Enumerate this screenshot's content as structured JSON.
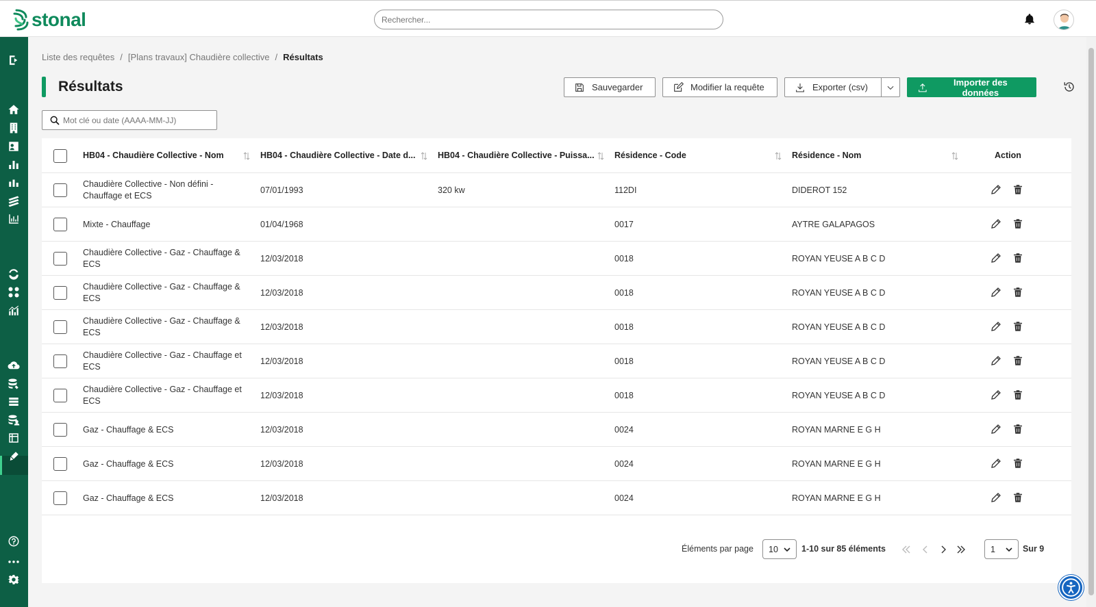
{
  "header": {
    "logo_text": "stonal",
    "search_placeholder": "Rechercher...",
    "icons": [
      "bell-icon",
      "user-avatar"
    ]
  },
  "sidebar": {
    "icons": [
      "collapse-icon",
      "home-icon",
      "building-icon",
      "contact-card-icon",
      "bar-chart-icon",
      "bar-chart-alt-icon",
      "layers-icon",
      "analytics-icon",
      "sync-icon",
      "apps-icon",
      "trend-chart-icon",
      "cloud-upload-icon",
      "database-edit-icon",
      "list-icon",
      "database-user-icon",
      "table-icon",
      "pen-icon",
      "help-icon",
      "more-icon",
      "settings-icon"
    ],
    "active": "database-user-icon"
  },
  "breadcrumb": {
    "items": [
      "Liste des requêtes",
      "[Plans travaux] Chaudière collective",
      "Résultats"
    ],
    "separator": "/"
  },
  "page": {
    "title": "Résultats"
  },
  "toolbar": {
    "save_label": "Sauvegarder",
    "edit_label": "Modifier la requête",
    "export_label": "Exporter (csv)",
    "import_label": "Importer des données"
  },
  "filter": {
    "placeholder": "Mot clé ou date (AAAA-MM-JJ)"
  },
  "table": {
    "columns": [
      "HB04 - Chaudière Collective - Nom",
      "HB04 - Chaudière Collective - Date d...",
      "HB04 - Chaudière Collective - Puissa...",
      "Résidence - Code",
      "Résidence - Nom",
      "Action"
    ],
    "rows": [
      {
        "nom": "Chaudière Collective - Non défini - Chauffage et ECS",
        "date": "07/01/1993",
        "puissance": "320 kw",
        "code": "112DI",
        "residence": "DIDEROT 152"
      },
      {
        "nom": "Mixte - Chauffage",
        "date": "01/04/1968",
        "puissance": "",
        "code": "0017",
        "residence": "AYTRE GALAPAGOS"
      },
      {
        "nom": "Chaudière Collective - Gaz - Chauffage & ECS",
        "date": "12/03/2018",
        "puissance": "",
        "code": "0018",
        "residence": "ROYAN YEUSE A B C D"
      },
      {
        "nom": "Chaudière Collective - Gaz - Chauffage & ECS",
        "date": "12/03/2018",
        "puissance": "",
        "code": "0018",
        "residence": "ROYAN YEUSE A B C D"
      },
      {
        "nom": "Chaudière Collective - Gaz - Chauffage & ECS",
        "date": "12/03/2018",
        "puissance": "",
        "code": "0018",
        "residence": "ROYAN YEUSE A B C D"
      },
      {
        "nom": "Chaudière Collective - Gaz - Chauffage et ECS",
        "date": "12/03/2018",
        "puissance": "",
        "code": "0018",
        "residence": "ROYAN YEUSE A B C D"
      },
      {
        "nom": "Chaudière Collective - Gaz - Chauffage et ECS",
        "date": "12/03/2018",
        "puissance": "",
        "code": "0018",
        "residence": "ROYAN YEUSE A B C D"
      },
      {
        "nom": "Gaz - Chauffage & ECS",
        "date": "12/03/2018",
        "puissance": "",
        "code": "0024",
        "residence": "ROYAN MARNE E G H"
      },
      {
        "nom": "Gaz - Chauffage & ECS",
        "date": "12/03/2018",
        "puissance": "",
        "code": "0024",
        "residence": "ROYAN MARNE E G H"
      },
      {
        "nom": "Gaz - Chauffage & ECS",
        "date": "12/03/2018",
        "puissance": "",
        "code": "0024",
        "residence": "ROYAN MARNE E G H"
      }
    ]
  },
  "pagination": {
    "per_page_label": "Éléments par page",
    "per_page_value": "10",
    "range_text": "1-10 sur 85 éléments",
    "page_value": "1",
    "total_pages_text": "Sur 9"
  }
}
